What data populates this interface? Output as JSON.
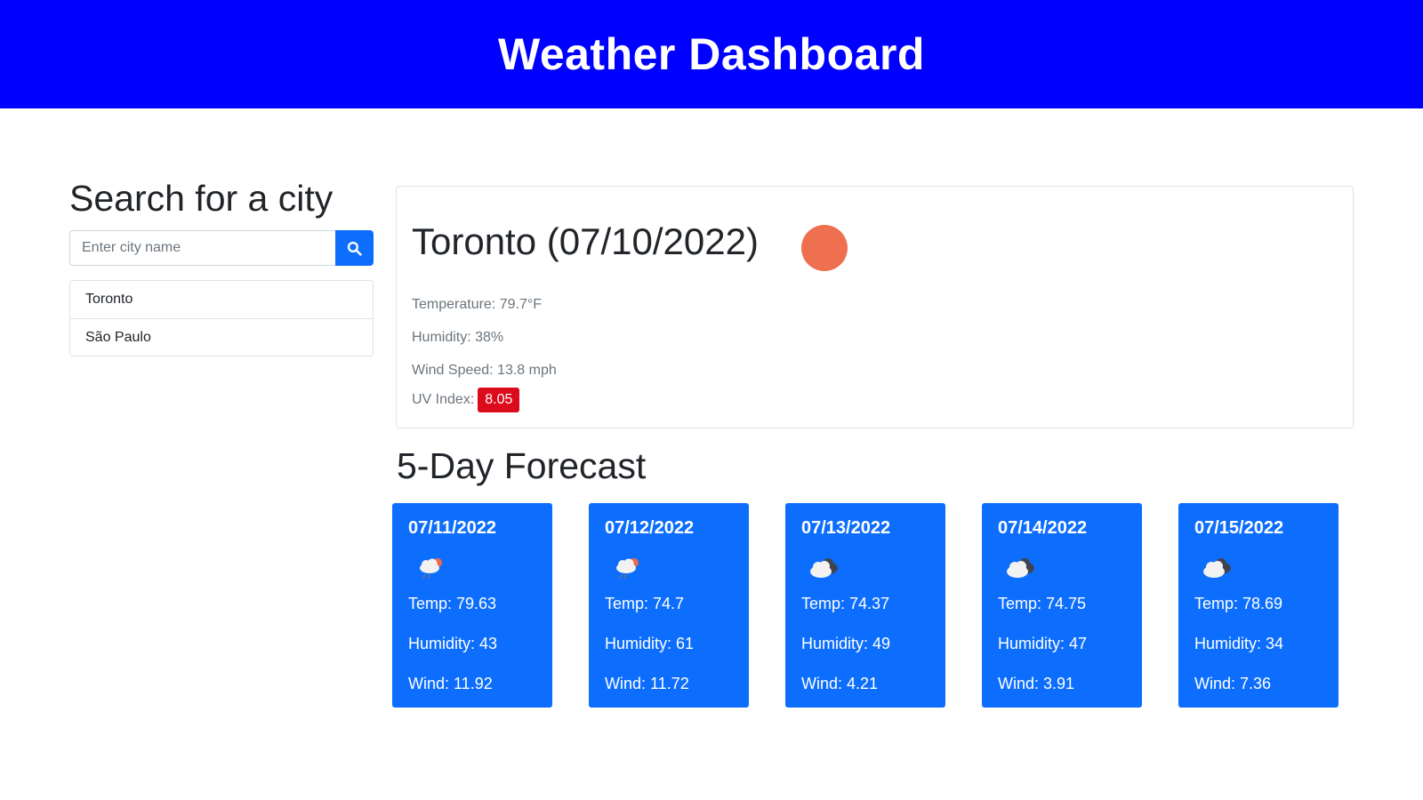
{
  "header": {
    "title": "Weather Dashboard"
  },
  "search": {
    "title": "Search for a city",
    "placeholder": "Enter city name",
    "button_icon": "search-icon"
  },
  "history": [
    "Toronto",
    "São Paulo"
  ],
  "current": {
    "title": "Toronto (07/10/2022)",
    "icon": "sun-dot-icon",
    "temperature": "Temperature: 79.7°F",
    "humidity": "Humidity: 38%",
    "wind": "Wind Speed: 13.8 mph",
    "uv_label": "UV Index:",
    "uv_value": "8.05",
    "uv_color": "#dc0b1b"
  },
  "forecast": {
    "title": "5-Day Forecast",
    "days": [
      {
        "date": "07/11/2022",
        "icon": "cloud-rain-sun-icon",
        "temp": "Temp: 79.63",
        "humidity": "Humidity: 43",
        "wind": "Wind: 11.92"
      },
      {
        "date": "07/12/2022",
        "icon": "cloud-rain-sun-icon",
        "temp": "Temp: 74.7",
        "humidity": "Humidity: 61",
        "wind": "Wind: 11.72"
      },
      {
        "date": "07/13/2022",
        "icon": "clouds-icon",
        "temp": "Temp: 74.37",
        "humidity": "Humidity: 49",
        "wind": "Wind: 4.21"
      },
      {
        "date": "07/14/2022",
        "icon": "clouds-icon",
        "temp": "Temp: 74.75",
        "humidity": "Humidity: 47",
        "wind": "Wind: 3.91"
      },
      {
        "date": "07/15/2022",
        "icon": "clouds-icon",
        "temp": "Temp: 78.69",
        "humidity": "Humidity: 34",
        "wind": "Wind: 7.36"
      }
    ]
  },
  "colors": {
    "header_bg": "#0000ff",
    "accent": "#0d6efd",
    "uv_high": "#dc0b1b",
    "sun": "#ee7050"
  }
}
